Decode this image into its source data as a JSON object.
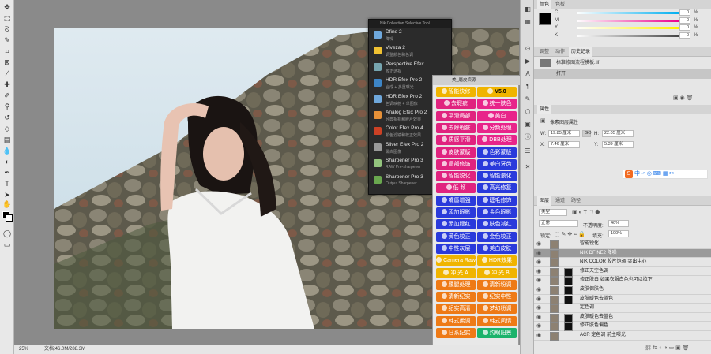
{
  "toolbar": {
    "tools": [
      "move",
      "marquee",
      "lasso",
      "quick-select",
      "crop",
      "frame",
      "eyedropper",
      "healing",
      "brush",
      "clone",
      "history-brush",
      "eraser",
      "gradient",
      "blur",
      "dodge",
      "pen",
      "type",
      "path-select",
      "rectangle",
      "hand",
      "zoom",
      "more"
    ]
  },
  "nik": {
    "title": "Nik Collection Selective Tool",
    "items": [
      {
        "name": "Dfine 2",
        "sub": "降噪",
        "color": "#6fa8dc"
      },
      {
        "name": "Viveza 2",
        "sub": "调整颜色和色调",
        "color": "#f1c232"
      },
      {
        "name": "Perspective Efex",
        "sub": "校正透视",
        "color": "#76a5af"
      },
      {
        "name": "HDR Efex Pro 2",
        "sub": "合成 + 多重曝光",
        "color": "#3d85c6"
      },
      {
        "name": "HDR Efex Pro 2",
        "sub": "色调映射 + 单图像",
        "color": "#6fa8dc"
      },
      {
        "name": "Analog Efex Pro 2",
        "sub": "经典相机和胶片效果",
        "color": "#e69138"
      },
      {
        "name": "Color Efex Pro 4",
        "sub": "颜色滤镜和校正效果",
        "color": "#cc4125"
      },
      {
        "name": "Silver Efex Pro 2",
        "sub": "黑白图像",
        "color": "#999999"
      },
      {
        "name": "Sharpener Pro 3",
        "sub": "RAW Pre-sharpener",
        "color": "#93c47d"
      },
      {
        "name": "Sharpener Pro 3",
        "sub": "Output Sharpener",
        "color": "#6aa84f"
      }
    ]
  },
  "beauty": {
    "tab": "美_磨皮资源",
    "buttons": [
      [
        "智能快修",
        "V5.0"
      ],
      [
        "去瑕疵",
        "统一肤色"
      ],
      [
        "平滑局部",
        "美白"
      ],
      [
        "去除瑕疵",
        "分频处理"
      ],
      [
        "质感平滑",
        "DBB处理"
      ],
      [
        "皮肤蒙版",
        "色彩蒙版"
      ],
      [
        "局部修饰",
        "美白牙齿"
      ],
      [
        "智能锐化",
        "智能液化"
      ],
      [
        "低 频",
        "高光修复"
      ],
      [
        "嘴唇增强",
        "睫毛修饰"
      ],
      [
        "添加眼影",
        "金色眼影"
      ],
      [
        "添加腮红",
        "肤色减红"
      ],
      [
        "黄色校正",
        "金色校正"
      ],
      [
        "中性灰层",
        "美白皮肤"
      ],
      [
        "Camera Raw",
        "HDR效果"
      ],
      [
        "冲 光 A",
        "冲 光 B"
      ],
      [
        "腰腿处理",
        "清新粉调"
      ],
      [
        "清新纪实",
        "纪实中性"
      ],
      [
        "纪实高清",
        "梦幻粉调"
      ],
      [
        "韩式柔调",
        "韩式风情"
      ],
      [
        "日系纪实",
        "灼眼阳景"
      ]
    ]
  },
  "status": {
    "zoom": "25%",
    "doc": "文档:46.0M/288.3M"
  },
  "color_panel": {
    "tabs": [
      "颜色",
      "色板"
    ],
    "sliders": [
      {
        "label": "C",
        "value": "0",
        "color": "#00aeef"
      },
      {
        "label": "M",
        "value": "0",
        "color": "#ec008c"
      },
      {
        "label": "Y",
        "value": "0",
        "color": "#fff200"
      },
      {
        "label": "K",
        "value": "0",
        "color": "#444444"
      }
    ],
    "pct": "%"
  },
  "history_panel": {
    "tabs": [
      "调整",
      "动作",
      "历史记录"
    ],
    "snapshot": "标准修图流程模板.tif",
    "entries": [
      "打开"
    ]
  },
  "properties": {
    "tab": "属性",
    "heading": "像素图层属性",
    "w_label": "W:",
    "w_value": "19.85 厘米",
    "h_label": "H:",
    "h_value": "22.05 厘米",
    "x_label": "X:",
    "x_value": "7.46 厘米",
    "y_label": "Y:",
    "y_value": "5.39 厘米",
    "link": "GO"
  },
  "layers_panel": {
    "tabs": [
      "图层",
      "通道",
      "路径"
    ],
    "kind": "类型",
    "blend": "正常",
    "opacity_label": "不透明度:",
    "opacity": "40%",
    "lock_label": "锁定:",
    "fill_label": "填充:",
    "fill": "100%",
    "layers": [
      {
        "name": "智能锐化",
        "selected": false,
        "mask": false
      },
      {
        "name": "NIK DFINE2 降噪",
        "selected": true,
        "mask": false
      },
      {
        "name": "NIK COLOR 胶片饱调 突出中心",
        "selected": false,
        "mask": false
      },
      {
        "name": "修正天空色调",
        "selected": false,
        "mask": true
      },
      {
        "name": "修正肤白 如果衣服白色也可以拉下",
        "selected": false,
        "mask": true
      },
      {
        "name": "皮肤保肤色",
        "selected": false,
        "mask": true
      },
      {
        "name": "皮肤暖色去蓝色",
        "selected": false,
        "mask": true
      },
      {
        "name": "定色调",
        "selected": false,
        "mask": false
      },
      {
        "name": "皮肤暖色去蓝色",
        "selected": false,
        "mask": true
      },
      {
        "name": "修正肤色偏色",
        "selected": false,
        "mask": true
      },
      {
        "name": "ACR 定色调 前主曝光",
        "selected": false,
        "mask": false
      }
    ]
  }
}
